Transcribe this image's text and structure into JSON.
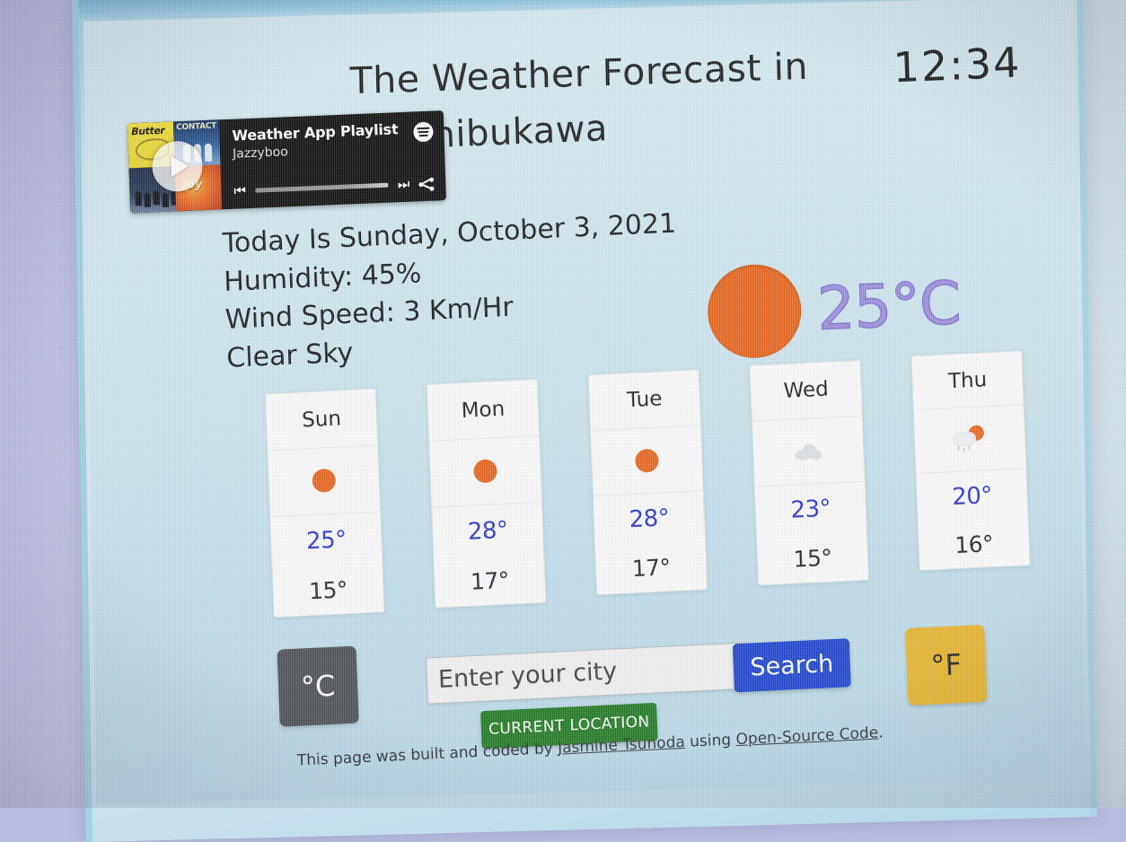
{
  "app": {
    "title_main": "The Weather Forecast in",
    "city": "Shibukawa",
    "clock": "12:34"
  },
  "spotify": {
    "playlist_title": "Weather App Playlist",
    "artist": "Jazzyboo",
    "icons": {
      "play": "play-icon",
      "previous": "previous-track-icon",
      "next": "next-track-icon",
      "share": "share-icon",
      "logo": "spotify-logo-icon"
    },
    "album_art": [
      "Butter",
      "CONTACT",
      "band-photo",
      "Joy"
    ]
  },
  "info": {
    "today": "Today Is Sunday, October 3, 2021",
    "humidity": "Humidity: 45%",
    "wind": "Wind Speed: 3 Km/Hr",
    "description": "Clear Sky"
  },
  "current": {
    "temperature": "25°C",
    "icon": "sun-icon"
  },
  "forecast": [
    {
      "day": "Sun",
      "icon": "sun-icon",
      "high": "25°",
      "low": "15°"
    },
    {
      "day": "Mon",
      "icon": "sun-icon",
      "high": "28°",
      "low": "17°"
    },
    {
      "day": "Tue",
      "icon": "sun-icon",
      "high": "28°",
      "low": "17°"
    },
    {
      "day": "Wed",
      "icon": "cloud-icon",
      "high": "23°",
      "low": "15°"
    },
    {
      "day": "Thu",
      "icon": "sun-rain-icon",
      "high": "20°",
      "low": "16°"
    }
  ],
  "controls": {
    "celsius_label": "°C",
    "fahrenheit_label": "°F",
    "search_placeholder": "Enter your city",
    "search_value": "",
    "search_button": "Search",
    "current_location_button": "CURRENT LOCATION"
  },
  "footer": {
    "prefix": "This page was built and coded by ",
    "author": "Jasmine Tsunoda",
    "middle": " using ",
    "source": "Open-Source Code",
    "suffix": "."
  },
  "colors": {
    "sun_orange": "#e8641b",
    "temp_purple": "#9d8fe0",
    "high_blue": "#2433c4",
    "search_blue": "#1a43d0",
    "location_green": "#1f7a22",
    "fahrenheit_yellow": "#e8b52b",
    "celsius_gray": "#4a4f54",
    "app_background": "#cde6f0"
  }
}
